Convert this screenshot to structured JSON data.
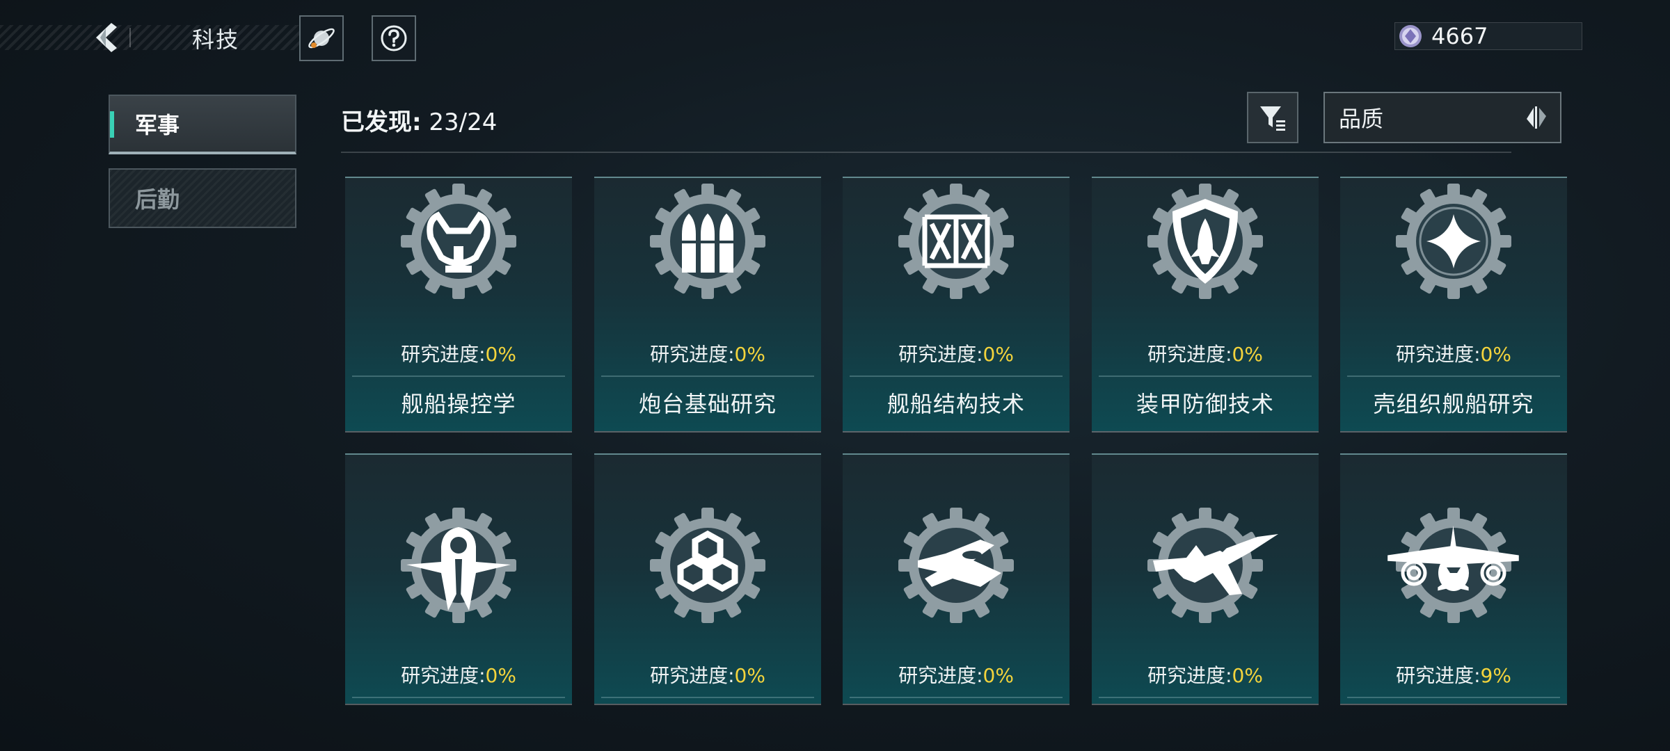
{
  "header": {
    "title": "科技",
    "currency": "4667"
  },
  "sidebar": {
    "tabs": [
      {
        "label": "军事",
        "active": true
      },
      {
        "label": "后勤",
        "active": false
      }
    ]
  },
  "toolbar": {
    "discovered_label": "已发现:",
    "discovered_value": "23/24",
    "sort_label": "品质"
  },
  "colors": {
    "accent": "#39d1b6",
    "progress_value": "#f4d43c"
  },
  "cards": [
    {
      "name": "舰船操控学",
      "progress_label": "研究进度:",
      "progress": "0%",
      "icon": "steering-wheel-icon"
    },
    {
      "name": "炮台基础研究",
      "progress_label": "研究进度:",
      "progress": "0%",
      "icon": "ammunition-icon"
    },
    {
      "name": "舰船结构技术",
      "progress_label": "研究进度:",
      "progress": "0%",
      "icon": "hull-frame-icon"
    },
    {
      "name": "装甲防御技术",
      "progress_label": "研究进度:",
      "progress": "0%",
      "icon": "armor-shield-icon"
    },
    {
      "name": "壳组织舰船研究",
      "progress_label": "研究进度:",
      "progress": "0%",
      "icon": "four-point-star-icon"
    },
    {
      "name": "",
      "progress_label": "研究进度:",
      "progress": "0%",
      "icon": "winged-probe-icon"
    },
    {
      "name": "",
      "progress_label": "研究进度:",
      "progress": "0%",
      "icon": "hexagon-cluster-icon"
    },
    {
      "name": "",
      "progress_label": "研究进度:",
      "progress": "0%",
      "icon": "small-fighter-icon"
    },
    {
      "name": "",
      "progress_label": "研究进度:",
      "progress": "0%",
      "icon": "jet-fighter-icon"
    },
    {
      "name": "",
      "progress_label": "研究进度:",
      "progress": "9%",
      "icon": "twin-turbine-plane-icon"
    }
  ]
}
